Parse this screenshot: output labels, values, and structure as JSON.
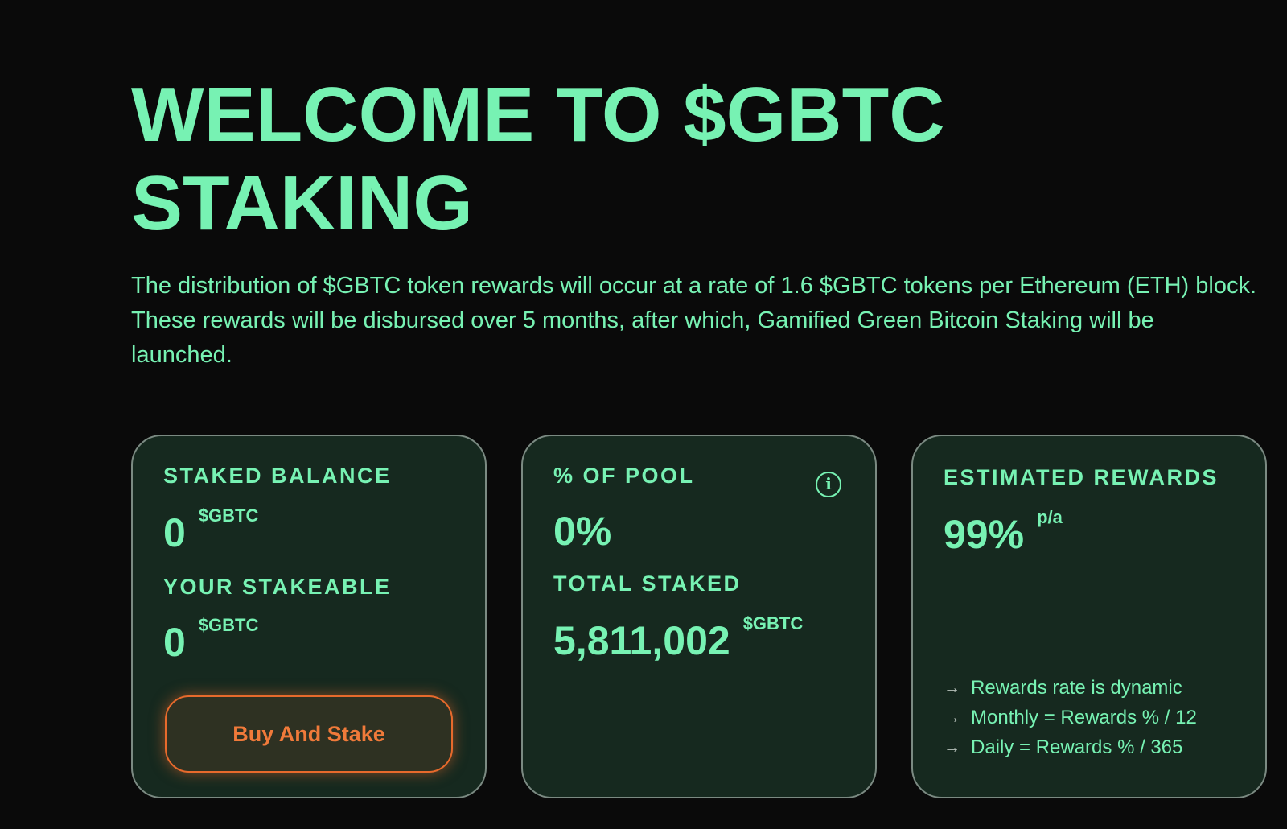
{
  "hero": {
    "title_line1": "WELCOME TO $GBTC",
    "title_line2": "STAKING",
    "description": "The distribution of $GBTC token rewards will occur at a rate of 1.6 $GBTC tokens per Ethereum (ETH) block. These rewards will be disbursed over 5 months, after which, Gamified Green Bitcoin Staking will be launched."
  },
  "cards": {
    "balance": {
      "staked_label": "STAKED BALANCE",
      "staked_value": "0",
      "staked_unit": "$GBTC",
      "stakeable_label": "YOUR STAKEABLE",
      "stakeable_value": "0",
      "stakeable_unit": "$GBTC",
      "button_label": "Buy And Stake"
    },
    "pool": {
      "pool_label": "% OF POOL",
      "pool_value": "0%",
      "info_icon": "info-icon",
      "total_label": "TOTAL STAKED",
      "total_value": "5,811,002",
      "total_unit": "$GBTC"
    },
    "rewards": {
      "label": "ESTIMATED REWARDS",
      "value": "99%",
      "unit": "p/a",
      "notes": [
        "Rewards rate is dynamic",
        "Monthly = Rewards % / 12",
        "Daily = Rewards % / 365"
      ],
      "note_icon": "arrow-right-icon"
    }
  },
  "colors": {
    "background": "#0a0a0a",
    "accent_green": "#77f2b3",
    "card_background": "#16291f",
    "card_border": "#7b8a82",
    "button_orange": "#e76a2c"
  }
}
